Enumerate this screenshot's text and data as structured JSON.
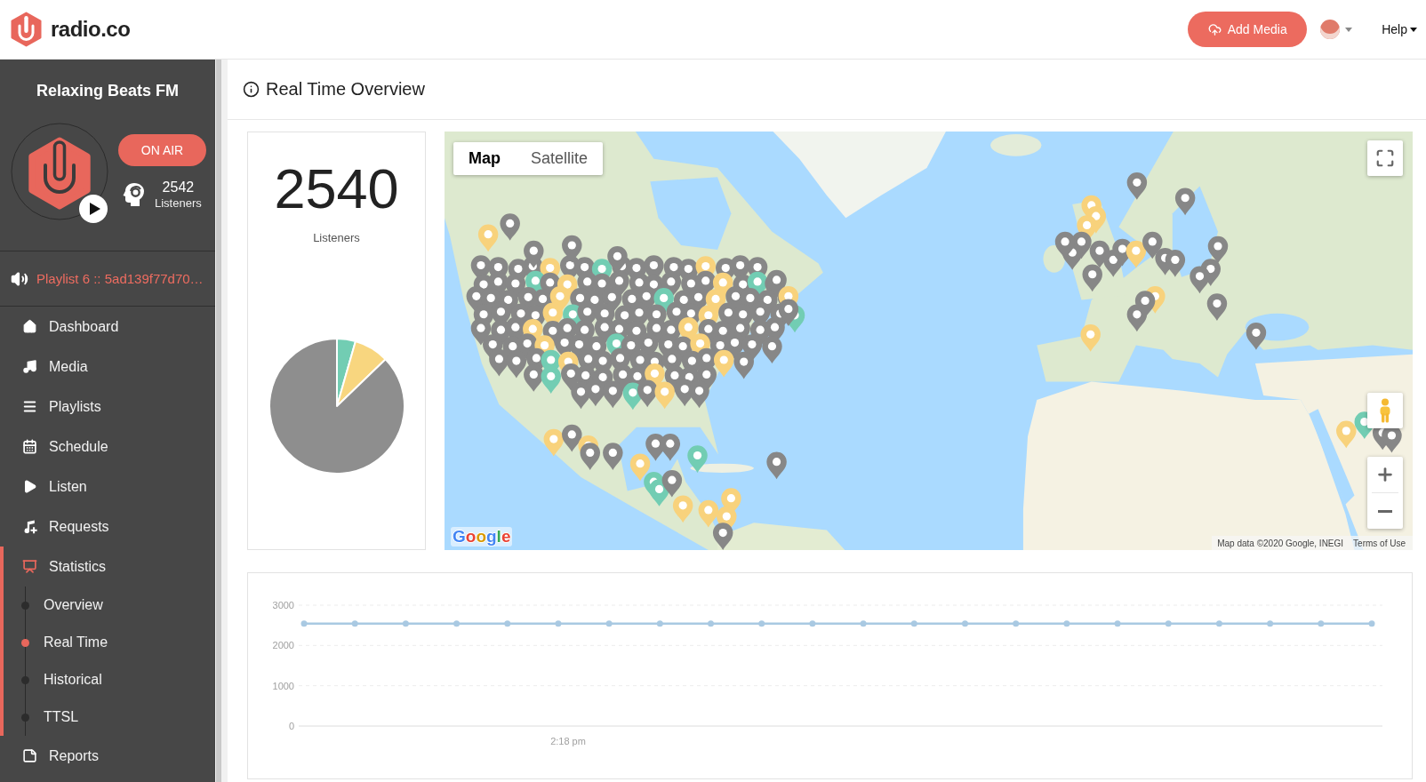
{
  "header": {
    "brand": "radio.co",
    "add_media": "Add Media",
    "help": "Help"
  },
  "station": {
    "name": "Relaxing Beats FM",
    "status": "ON AIR",
    "listeners": "2542",
    "listeners_label": "Listeners"
  },
  "now_playing": "Playlist 6 :: 5ad139f77d70…",
  "nav": [
    {
      "label": "Dashboard",
      "selected": false
    },
    {
      "label": "Media",
      "selected": false
    },
    {
      "label": "Playlists",
      "selected": false
    },
    {
      "label": "Schedule",
      "selected": false
    },
    {
      "label": "Listen",
      "selected": false
    },
    {
      "label": "Requests",
      "selected": false
    },
    {
      "label": "Statistics",
      "selected": true,
      "children": [
        {
          "label": "Overview",
          "selected": false
        },
        {
          "label": "Real Time",
          "selected": true
        },
        {
          "label": "Historical",
          "selected": false
        },
        {
          "label": "TTSL",
          "selected": false
        }
      ]
    },
    {
      "label": "Reports",
      "selected": false
    }
  ],
  "page": {
    "title": "Real Time Overview"
  },
  "listeners_card": {
    "count": "2540",
    "label": "Listeners"
  },
  "map": {
    "types": [
      {
        "label": "Map",
        "selected": true
      },
      {
        "label": "Satellite",
        "selected": false
      }
    ],
    "logo": "Google",
    "attribution": "Map data ©2020 Google, INEGI",
    "terms": "Terms of Use"
  },
  "chart": {
    "chart_data": {
      "type": "line",
      "categories": [
        null,
        null,
        null,
        null,
        null,
        null,
        null,
        null,
        null,
        null,
        null,
        null,
        null,
        null,
        null,
        null,
        null,
        null,
        null,
        null,
        null,
        null
      ],
      "series": [
        {
          "color": "#a9c9e2",
          "marker": "circle",
          "values": [
            2540,
            2540,
            2540,
            2540,
            2540,
            2540,
            2540,
            2540,
            2540,
            2540,
            2540,
            2540,
            2540,
            2540,
            2540,
            2540,
            2540,
            2540,
            2540,
            2540,
            2540,
            2540
          ]
        }
      ],
      "ylim": [
        0,
        3000
      ],
      "yticks": [
        {
          "value": 0,
          "label": "0"
        },
        {
          "value": 1000,
          "label": "1000"
        },
        {
          "value": 2000,
          "label": "2000"
        },
        {
          "value": 3000,
          "label": "3000"
        }
      ],
      "annotations": [
        "2:18 pm"
      ]
    }
  }
}
